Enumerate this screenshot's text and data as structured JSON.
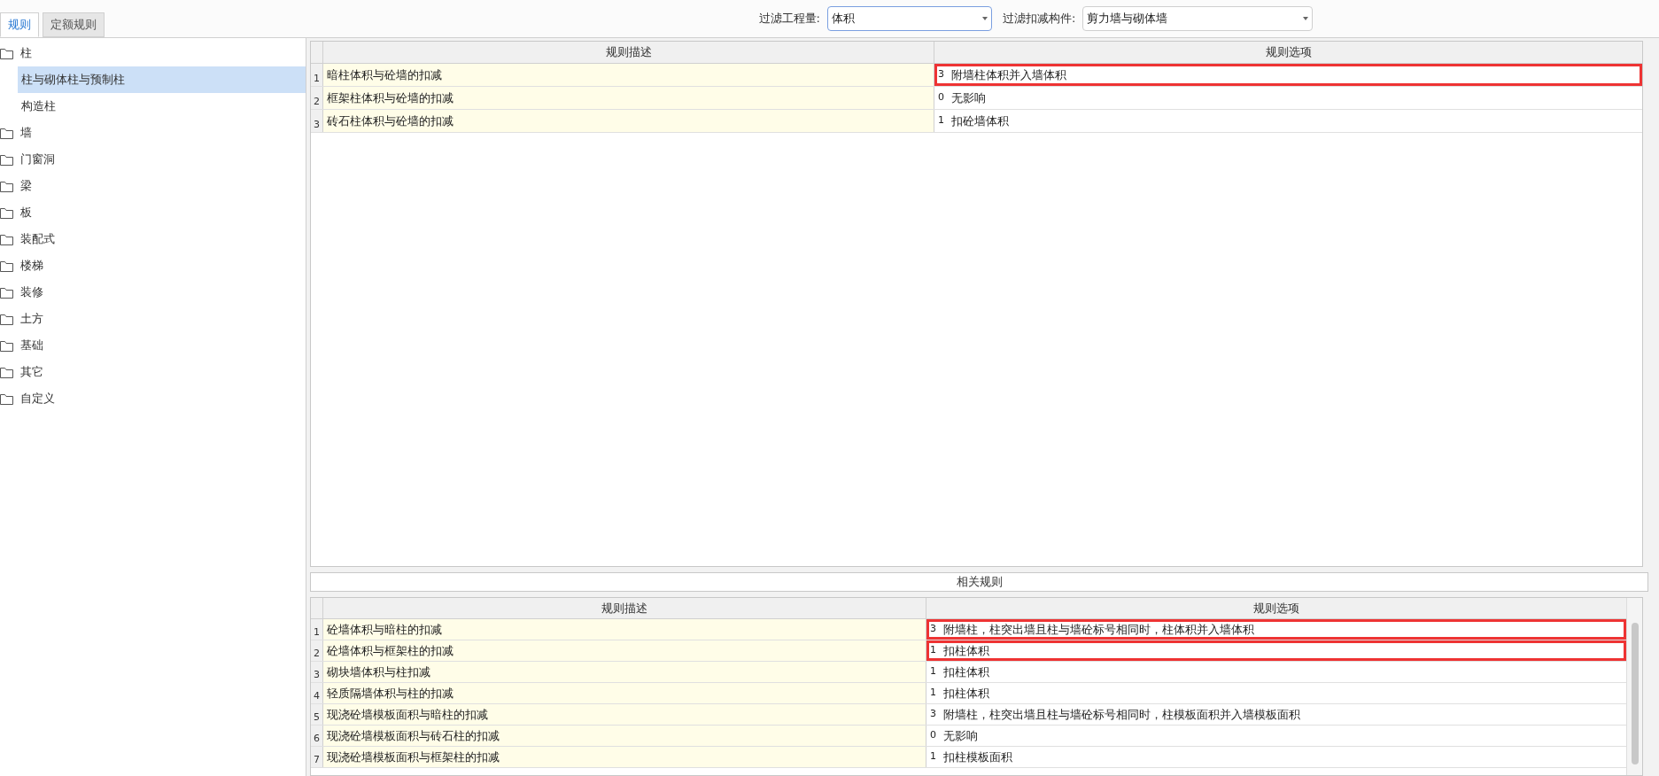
{
  "tabs": [
    {
      "label": "规则",
      "selected": true
    },
    {
      "label": "定额规则",
      "selected": false
    }
  ],
  "filters": [
    {
      "label": "过滤工程量:",
      "value": "体积",
      "focused": true
    },
    {
      "label": "过滤扣减构件:",
      "value": "剪力墙与砌体墙",
      "focused": false
    }
  ],
  "tree": [
    {
      "label": "柱",
      "children": [
        {
          "label": "柱与砌体柱与预制柱",
          "selected": true
        },
        {
          "label": "构造柱",
          "selected": false
        }
      ]
    },
    {
      "label": "墙"
    },
    {
      "label": "门窗洞"
    },
    {
      "label": "梁"
    },
    {
      "label": "板"
    },
    {
      "label": "装配式"
    },
    {
      "label": "楼梯"
    },
    {
      "label": "装修"
    },
    {
      "label": "土方"
    },
    {
      "label": "基础"
    },
    {
      "label": "其它"
    },
    {
      "label": "自定义"
    }
  ],
  "rules_table": {
    "columns": [
      "规则描述",
      "规则选项"
    ],
    "rows": [
      {
        "number": "1",
        "description": "暗柱体积与砼墙的扣减",
        "option_code": "3",
        "option": "附墙柱体积并入墙体积",
        "highlighted": true
      },
      {
        "number": "2",
        "description": "框架柱体积与砼墙的扣减",
        "option_code": "0",
        "option": "无影响",
        "highlighted": false
      },
      {
        "number": "3",
        "description": "砖石柱体积与砼墙的扣减",
        "option_code": "1",
        "option": "扣砼墙体积",
        "highlighted": false
      }
    ]
  },
  "related_rules": {
    "title": "相关规则",
    "columns": [
      "规则描述",
      "规则选项"
    ],
    "rows": [
      {
        "number": "1",
        "description": "砼墙体积与暗柱的扣减",
        "option_code": "3",
        "option": "附墙柱，柱突出墙且柱与墙砼标号相同时，柱体积并入墙体积",
        "highlighted": true
      },
      {
        "number": "2",
        "description": "砼墙体积与框架柱的扣减",
        "option_code": "1",
        "option": "扣柱体积",
        "highlighted": true
      },
      {
        "number": "3",
        "description": "砌块墙体积与柱扣减",
        "option_code": "1",
        "option": "扣柱体积",
        "highlighted": false
      },
      {
        "number": "4",
        "description": "轻质隔墙体积与柱的扣减",
        "option_code": "1",
        "option": "扣柱体积",
        "highlighted": false
      },
      {
        "number": "5",
        "description": "现浇砼墙模板面积与暗柱的扣减",
        "option_code": "3",
        "option": "附墙柱，柱突出墙且柱与墙砼标号相同时，柱模板面积并入墙模板面积",
        "highlighted": false
      },
      {
        "number": "6",
        "description": "现浇砼墙模板面积与砖石柱的扣减",
        "option_code": "0",
        "option": "无影响",
        "highlighted": false
      },
      {
        "number": "7",
        "description": "现浇砼墙模板面积与框架柱的扣减",
        "option_code": "1",
        "option": "扣柱模板面积",
        "highlighted": false
      }
    ]
  }
}
